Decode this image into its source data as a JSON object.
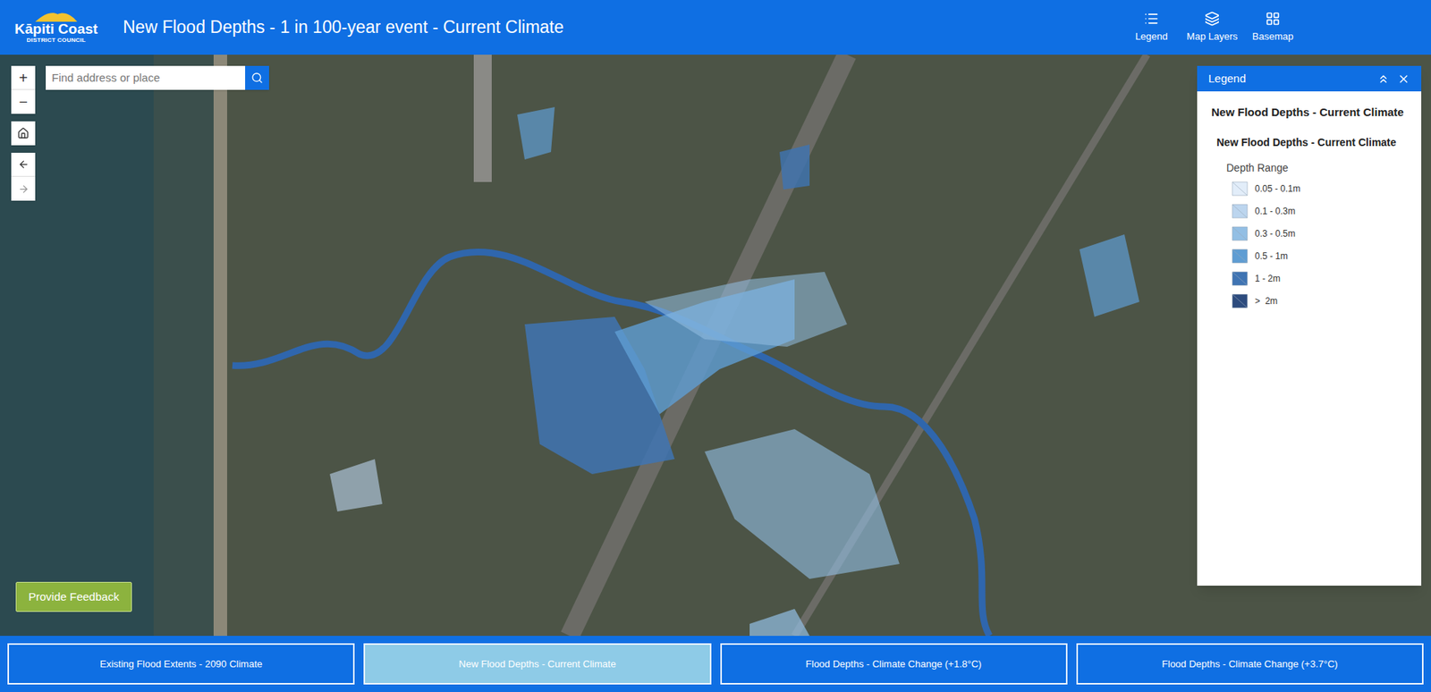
{
  "header": {
    "logo": {
      "name": "Kāpiti Coast",
      "subtitle": "DISTRICT COUNCIL"
    },
    "title": "New Flood Depths - 1 in 100-year event - Current Climate",
    "toolbar": [
      {
        "label": "Legend",
        "kind": "legend"
      },
      {
        "label": "Map Layers",
        "kind": "layers"
      },
      {
        "label": "Basemap",
        "kind": "basemap"
      }
    ]
  },
  "search": {
    "placeholder": "Find address or place"
  },
  "zoom": {
    "in": "+",
    "out": "−"
  },
  "legend": {
    "title": "Legend",
    "layer": "New Flood Depths - Current Climate",
    "sublayer": "New Flood Depths - Current Climate",
    "heading": "Depth Range",
    "items": [
      {
        "label": "0.05 - 0.1m",
        "color": "#e2edf9"
      },
      {
        "label": "0.1 - 0.3m",
        "color": "#bcd5ee"
      },
      {
        "label": "0.3 - 0.5m",
        "color": "#93bfe4"
      },
      {
        "label": "0.5 - 1m",
        "color": "#5f9dd3"
      },
      {
        "label": "1 - 2m",
        "color": "#3f74b3"
      },
      {
        "label": ">  2m",
        "color": "#2d4b7e"
      }
    ]
  },
  "feedback_button": "Provide Feedback",
  "tabs": [
    {
      "label": "Existing Flood Extents - 2090 Climate",
      "selected": false
    },
    {
      "label": "New Flood Depths - Current Climate",
      "selected": true
    },
    {
      "label": "Flood Depths - Climate Change (+1.8°C)",
      "selected": false
    },
    {
      "label": "Flood Depths - Climate Change (+3.7°C)",
      "selected": false
    }
  ]
}
